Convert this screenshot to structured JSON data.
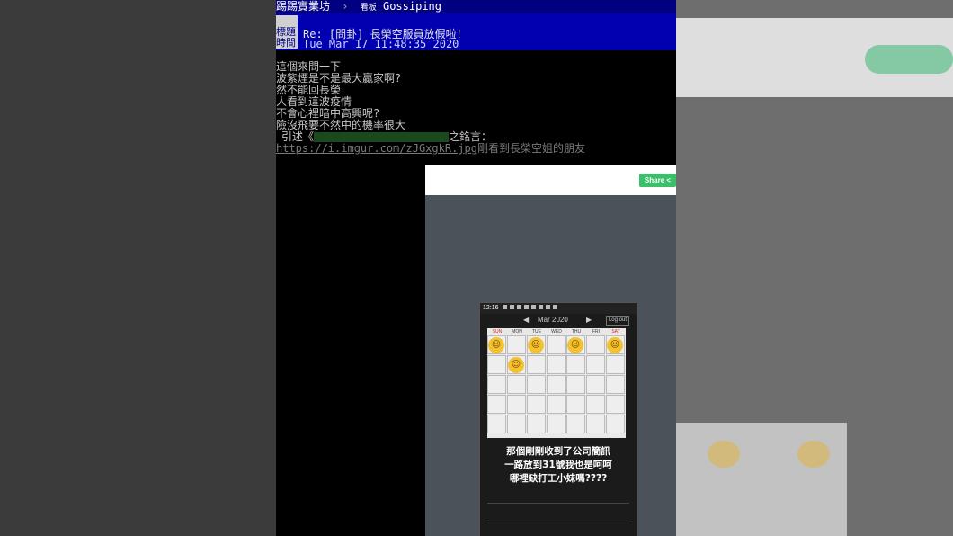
{
  "breadcrumb": {
    "site": "批踢踢實業坊",
    "board_tag": "看板",
    "board": "Gossiping"
  },
  "header": {
    "labels": [
      "標題",
      "時間"
    ],
    "title": "Re: [問卦] 長榮空服員放假啦！",
    "time": "Tue Mar 17 11:48:35 2020"
  },
  "body": {
    "lines": [
      "這個來問一下",
      "波紫煙是不是最大贏家啊?",
      "然不能回長榮",
      "人看到這波疫情",
      "不會心裡暗中高興呢?",
      "險沒飛要不然中的機率很大"
    ],
    "quote_prefix": "引述《",
    "quote_suffix": "之銘言：",
    "url": "https://i.imgur.com/zJGxgkR.jpg",
    "url_tail": "剛看到長榮空姐的朋友"
  },
  "screenshot": {
    "share_label": "Share",
    "status_time": "12:16",
    "month": "Mar 2020",
    "logout": "Log out",
    "days": [
      "SUN",
      "MON",
      "TUE",
      "WED",
      "THU",
      "FRI",
      "SAT"
    ],
    "message_lines": [
      "那個剛剛收到了公司簡訊",
      "一路放到31號我也是呵呵",
      "哪裡缺打工小妹嗎????"
    ]
  },
  "colors": {
    "topbar": "#000080",
    "header": "#0000b0",
    "quote": "#3fa33f",
    "share": "#3bbf6a"
  }
}
